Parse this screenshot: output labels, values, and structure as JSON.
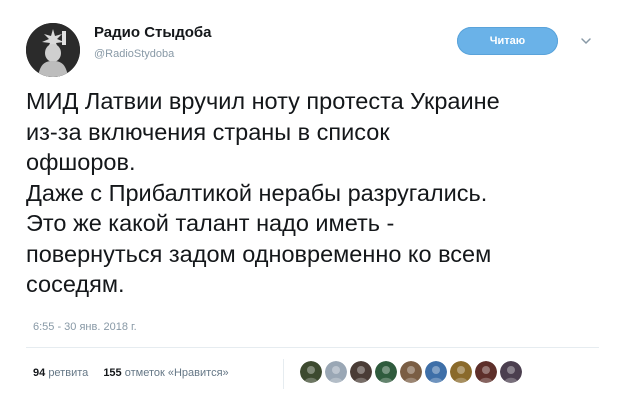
{
  "tweet": {
    "display_name": "Радио Стыдоба",
    "username": "@RadioStydoba",
    "follow_button_label": "Читаю",
    "text": "МИД Латвии вручил ноту протеста Украине\nиз-за включения страны в список\nофшоров.\nДаже с Прибалтикой нерабы разругались.\nЭто же какой талант надо иметь -\nповернуться задом одновременно ко всем\nсоседям.",
    "timestamp": "6:55 - 30 янв. 2018 г."
  },
  "stats": {
    "retweets_count": "94",
    "retweets_label": "ретвита",
    "likes_count": "155",
    "likes_label": "отметок «Нравится»"
  },
  "likers": [
    {
      "color": "#3d4a2f"
    },
    {
      "color": "#9aa7b5"
    },
    {
      "color": "#4a3c36"
    },
    {
      "color": "#2f5b3d"
    },
    {
      "color": "#7a5e44"
    },
    {
      "color": "#3e6fa8"
    },
    {
      "color": "#8a6a2b"
    },
    {
      "color": "#5e2f2a"
    },
    {
      "color": "#4b3f4f"
    }
  ],
  "colors": {
    "follow_button": "#6ab2e8",
    "muted_text": "#8899a6"
  }
}
